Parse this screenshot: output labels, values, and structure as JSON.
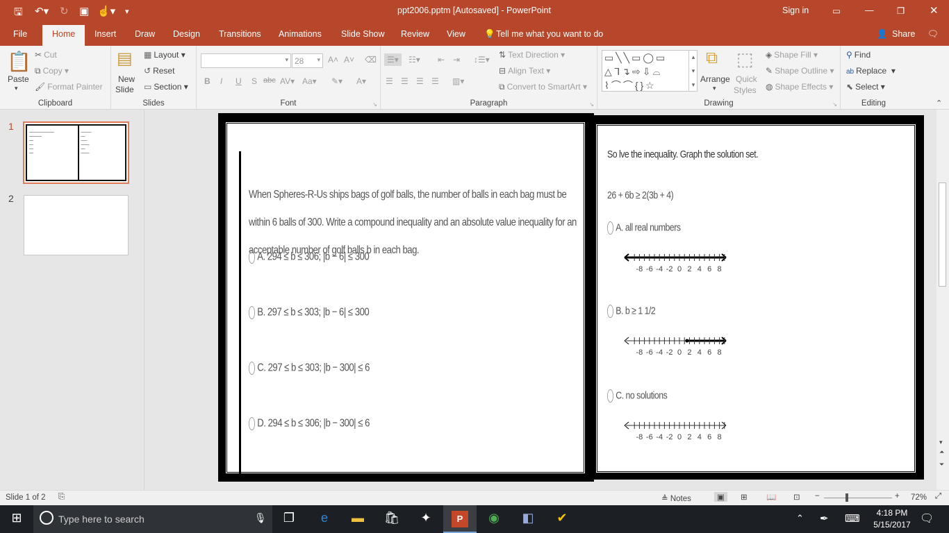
{
  "titlebar": {
    "title": "ppt2006.pptm [Autosaved]  -  PowerPoint",
    "sign_in": "Sign in"
  },
  "tabs": [
    "File",
    "Home",
    "Insert",
    "Draw",
    "Design",
    "Transitions",
    "Animations",
    "Slide Show",
    "Review",
    "View"
  ],
  "tell_me": "Tell me what you want to do",
  "share": "Share",
  "ribbon": {
    "clipboard": {
      "label": "Clipboard",
      "paste": "Paste",
      "cut": "Cut",
      "copy": "Copy",
      "format_painter": "Format Painter"
    },
    "slides": {
      "label": "Slides",
      "new_slide": "New",
      "new_slide2": "Slide",
      "layout": "Layout",
      "reset": "Reset",
      "section": "Section"
    },
    "font": {
      "label": "Font",
      "font_name": "",
      "font_size": "28"
    },
    "paragraph": {
      "label": "Paragraph",
      "text_direction": "Text Direction",
      "align_text": "Align Text",
      "convert": "Convert to SmartArt"
    },
    "drawing": {
      "label": "Drawing",
      "arrange": "Arrange",
      "quick_styles": "Quick",
      "quick_styles2": "Styles",
      "shape_fill": "Shape Fill",
      "shape_outline": "Shape Outline",
      "shape_effects": "Shape Effects"
    },
    "editing": {
      "label": "Editing",
      "find": "Find",
      "replace": "Replace",
      "select": "Select"
    }
  },
  "thumbnails": [
    "1",
    "2"
  ],
  "slide_left": {
    "question": "When Spheres-R-Us ships bags of golf balls, the number of balls in each bag must be within 6 balls of 300. Write a compound inequality and an absolute value inequality for an acceptable number of golf balls b in each bag.",
    "options": [
      "A. 294 ≤ b ≤ 306; |b − 6| ≤ 300",
      "B. 297 ≤ b ≤ 303; |b − 6| ≤ 300",
      "C. 297 ≤ b ≤ 303; |b − 300| ≤ 6",
      "D. 294 ≤ b ≤ 306; |b − 300| ≤ 6"
    ]
  },
  "slide_right": {
    "instruction": "So lve the inequality. Graph the solution set.",
    "inequality": "26 + 6b ≥ 2(3b + 4)",
    "options": [
      {
        "label": "A. all real numbers",
        "shade_from": null,
        "shade_all": true
      },
      {
        "label": "B. b ≥ 1 1/2",
        "shade_from": 1.5,
        "shade_all": false
      },
      {
        "label": "C. no solutions",
        "shade_from": null,
        "shade_all": false
      }
    ],
    "tick_labels": [
      "-8",
      "-6",
      "-4",
      "-2",
      "0",
      "2",
      "4",
      "6",
      "8"
    ]
  },
  "status": {
    "slide": "Slide 1 of 2",
    "notes": "Notes",
    "zoom": "72%"
  },
  "taskbar": {
    "search": "Type here to search",
    "time": "4:18 PM",
    "date": "5/15/2017"
  }
}
